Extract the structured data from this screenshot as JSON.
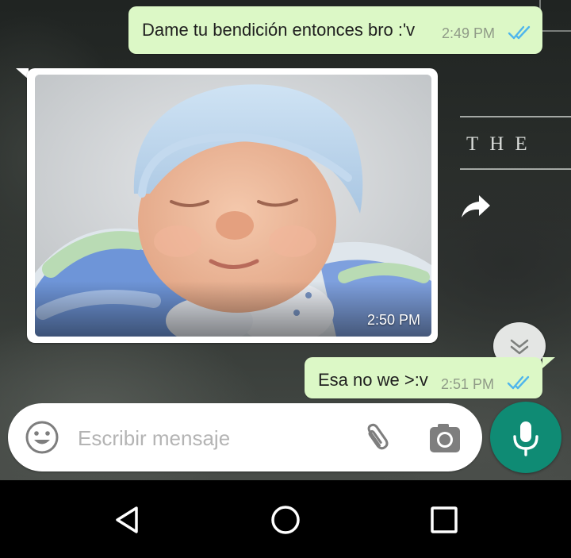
{
  "chat": {
    "messages": [
      {
        "direction": "outgoing",
        "text": "Dame tu bendición entonces bro :'v",
        "time": "2:49 PM",
        "status": "read"
      },
      {
        "direction": "incoming",
        "type": "image",
        "image_desc": "baby-photo",
        "time": "2:50 PM"
      },
      {
        "direction": "outgoing",
        "text": "Esa no we >:v",
        "time": "2:51 PM",
        "status": "read"
      }
    ]
  },
  "wallpaper": {
    "text": "THE"
  },
  "input": {
    "placeholder": "Escribir mensaje",
    "value": ""
  },
  "colors": {
    "outgoing_bubble": "#dcf8c6",
    "incoming_bubble": "#ffffff",
    "read_ticks": "#4fb6ec",
    "mic_button": "#0f8b74"
  },
  "icons": {
    "emoji": "emoji-icon",
    "attach": "paperclip-icon",
    "camera": "camera-icon",
    "mic": "mic-icon",
    "share": "share-icon",
    "scroll_down": "double-chevron-down-icon",
    "nav_back": "back-triangle-icon",
    "nav_home": "home-circle-icon",
    "nav_recents": "recents-square-icon"
  }
}
